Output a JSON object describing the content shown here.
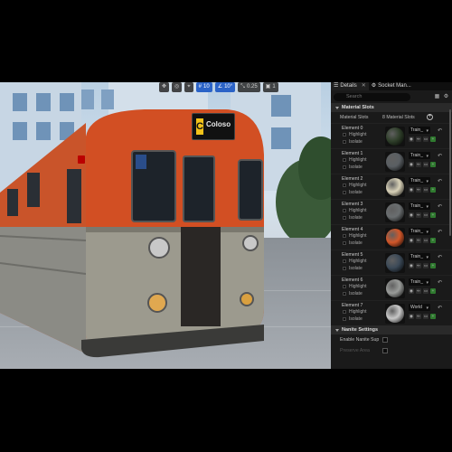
{
  "viewport": {
    "toolbar": {
      "grid_snap": "10",
      "rotate_snap": "10°",
      "scale_snap": "0.25",
      "camera_speed": "1"
    },
    "destination_sign": {
      "letter": "C",
      "text": "Coloso"
    }
  },
  "panel": {
    "tabs": [
      {
        "label": "Details",
        "active": true
      },
      {
        "label": "Socket Man...",
        "active": false
      }
    ],
    "search": {
      "placeholder": "Search"
    },
    "material_section": {
      "title": "Material Slots"
    },
    "slots_header": {
      "label": "Material Slots",
      "count": "8 Material Slots"
    },
    "elements": [
      {
        "name": "Element 0",
        "highlight": "Highlight",
        "isolate": "Isolate",
        "material": "Train_",
        "color": "#2f3f2a"
      },
      {
        "name": "Element 1",
        "highlight": "Highlight",
        "isolate": "Isolate",
        "material": "Train_",
        "color": "#5a5f63"
      },
      {
        "name": "Element 2",
        "highlight": "Highlight",
        "isolate": "Isolate",
        "material": "Train_",
        "color": "#d9d2b8"
      },
      {
        "name": "Element 3",
        "highlight": "Highlight",
        "isolate": "Isolate",
        "material": "Train_",
        "color": "#6a6e70"
      },
      {
        "name": "Element 4",
        "highlight": "Highlight",
        "isolate": "Isolate",
        "material": "Train_",
        "color": "#d2572a"
      },
      {
        "name": "Element 5",
        "highlight": "Highlight",
        "isolate": "Isolate",
        "material": "Train_",
        "color": "#3c4a58"
      },
      {
        "name": "Element 6",
        "highlight": "Highlight",
        "isolate": "Isolate",
        "material": "Train_",
        "color": "#9a9c9a"
      },
      {
        "name": "Element 7",
        "highlight": "Highlight",
        "isolate": "Isolate",
        "material": "World",
        "color": "#c8c8c8"
      }
    ],
    "nanite_section": {
      "title": "Nanite Settings"
    },
    "nanite_rows": [
      {
        "label": "Enable Nanite Sup"
      },
      {
        "label": "Preserve Area"
      }
    ]
  }
}
